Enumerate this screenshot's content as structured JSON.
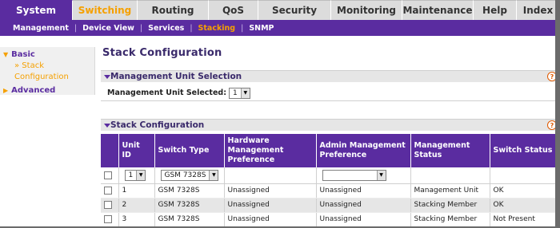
{
  "topnav": {
    "tabs": [
      {
        "label": "System",
        "w": 91
      },
      {
        "label": "Switching",
        "w": 81
      },
      {
        "label": "Routing",
        "w": 89
      },
      {
        "label": "QoS",
        "w": 62
      },
      {
        "label": "Security",
        "w": 91
      },
      {
        "label": "Monitoring",
        "w": 89
      },
      {
        "label": "Maintenance",
        "w": 89
      },
      {
        "label": "Help",
        "w": 54
      },
      {
        "label": "Index",
        "w": 54
      }
    ]
  },
  "subnav": {
    "items": [
      "Management",
      "Device View",
      "Services",
      "Stacking",
      "SNMP"
    ]
  },
  "sidebar": {
    "basic": "Basic",
    "stack_config_line1": "» Stack",
    "stack_config_line2": "Configuration",
    "advanced": "Advanced"
  },
  "page": {
    "title": "Stack Configuration",
    "mgmt_section": "Management Unit Selection",
    "mgmt_label": "Management Unit Selected:",
    "mgmt_value": "1",
    "stack_section": "Stack Configuration",
    "help": "?"
  },
  "table": {
    "headers": [
      "Unit ID",
      "Switch Type",
      "Hardware Management Preference",
      "Admin Management Preference",
      "Management Status",
      "Switch Status"
    ],
    "edit_unit": "1",
    "edit_type": "GSM 7328S",
    "rows": [
      {
        "unit": "1",
        "type": "GSM 7328S",
        "hw": "Unassigned",
        "admin": "Unassigned",
        "mgmt": "Management Unit",
        "status": "OK"
      },
      {
        "unit": "2",
        "type": "GSM 7328S",
        "hw": "Unassigned",
        "admin": "Unassigned",
        "mgmt": "Stacking Member",
        "status": "OK"
      },
      {
        "unit": "3",
        "type": "GSM 7328S",
        "hw": "Unassigned",
        "admin": "Unassigned",
        "mgmt": "Stacking Member",
        "status": "Not Present"
      }
    ]
  }
}
